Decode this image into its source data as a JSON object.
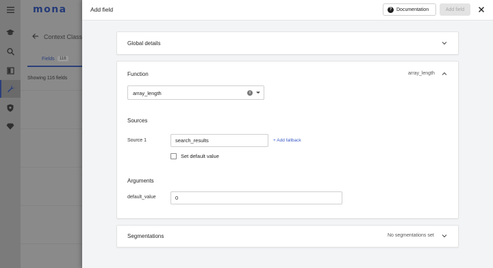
{
  "app": {
    "logo": "mona",
    "back_title": "Context Class",
    "tab_label": "Fields",
    "tab_count": "116",
    "showing_text": "Showing 116 fields"
  },
  "drawer": {
    "title": "Add field",
    "documentation_label": "Documentation",
    "add_field_label": "Add field"
  },
  "global_details": {
    "title": "Global details"
  },
  "function": {
    "title": "Function",
    "summary": "array_length",
    "selected_value": "array_length",
    "sources_title": "Sources",
    "source_label": "Source 1",
    "source_value": "search_results",
    "add_fallback": "+ Add fallback",
    "default_value_checkbox_label": "Set default value",
    "arguments_title": "Arguments",
    "argument_label": "default_value",
    "argument_value": "0"
  },
  "segmentations": {
    "title": "Segmentations",
    "summary": "No segmentations set"
  },
  "icons": {
    "menu": "menu-icon",
    "back": "back-arrow-icon",
    "help": "help-circle-icon",
    "close": "close-icon",
    "info": "info-icon",
    "chevron_down": "chevron-down-icon",
    "chevron_up": "chevron-up-icon"
  },
  "colors": {
    "brand": "#243a78",
    "link": "#3a5bc7",
    "overlay": "#8a8a8a",
    "drawer_bg": "#f3f4f6"
  }
}
